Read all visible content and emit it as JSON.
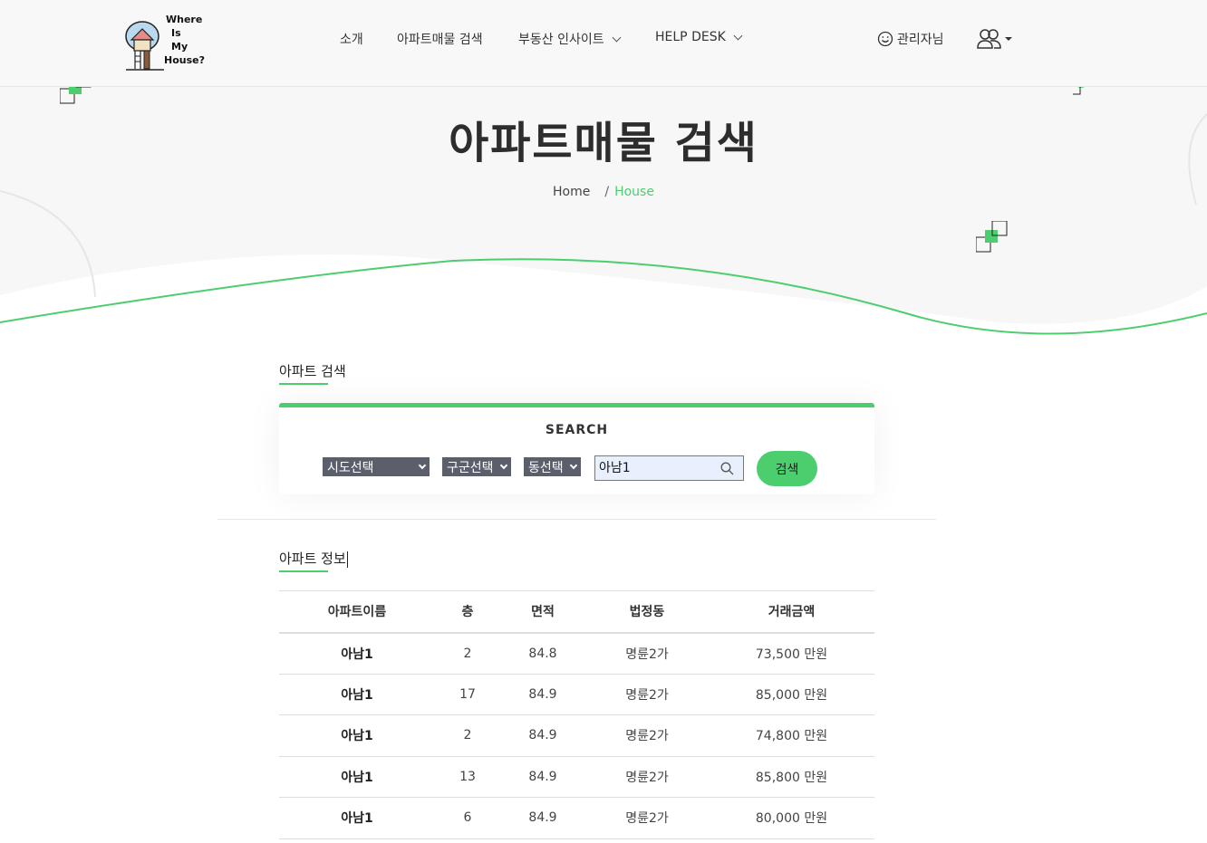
{
  "brand": {
    "logo_text": [
      "Where",
      "Is",
      "My",
      "House?"
    ]
  },
  "nav": {
    "items": [
      {
        "label": "소개",
        "dropdown": false
      },
      {
        "label": "아파트매물 검색",
        "dropdown": false
      },
      {
        "label": "부동산 인사이트",
        "dropdown": true
      },
      {
        "label": "HELP DESK",
        "dropdown": true
      }
    ],
    "admin_label": "관리자님"
  },
  "hero": {
    "title": "아파트매물 검색",
    "breadcrumb": {
      "home": "Home",
      "separator": "/",
      "current": "House"
    }
  },
  "search": {
    "section_title": "아파트 검색",
    "card_label": "SEARCH",
    "selects": {
      "sido": "시도선택",
      "gugun": "구군선택",
      "dong": "동선택"
    },
    "input_value": "아남1",
    "button_label": "검색"
  },
  "results": {
    "section_title": "아파트 정보",
    "columns": [
      "아파트이름",
      "층",
      "면적",
      "법정동",
      "거래금액"
    ],
    "rows": [
      [
        "아남1",
        "2",
        "84.8",
        "명륜2가",
        "73,500 만원"
      ],
      [
        "아남1",
        "17",
        "84.9",
        "명륜2가",
        "85,000 만원"
      ],
      [
        "아남1",
        "2",
        "84.9",
        "명륜2가",
        "74,800 만원"
      ],
      [
        "아남1",
        "13",
        "84.9",
        "명륜2가",
        "85,800 만원"
      ],
      [
        "아남1",
        "6",
        "84.9",
        "명륜2가",
        "80,000 만원"
      ]
    ]
  },
  "colors": {
    "accent": "#4cce6f",
    "select_bg": "#5a5f6b",
    "input_bg": "#e8f0fe",
    "hero_bg": "#f7f7f7"
  }
}
